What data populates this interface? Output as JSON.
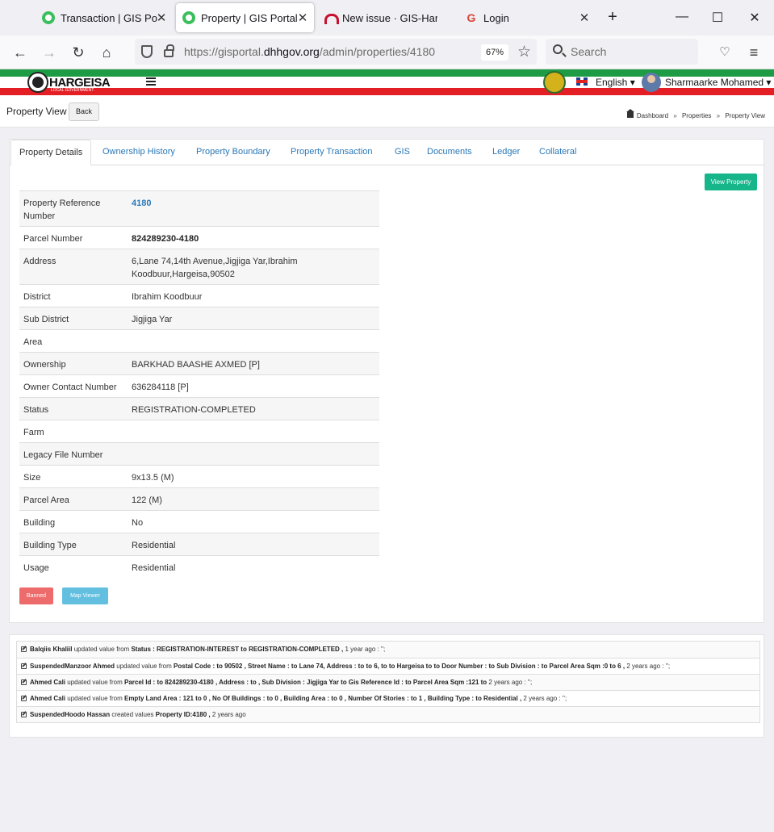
{
  "browser": {
    "tabs": [
      {
        "label": "Transaction | GIS Portal",
        "icon": "gis-favicon-icon",
        "active": false
      },
      {
        "label": "Property | GIS Portal",
        "icon": "gis-favicon-icon",
        "active": true
      },
      {
        "label": "New issue · GIS-Hargeisa",
        "icon": "issue-favicon-icon",
        "active": false
      },
      {
        "label": "Login",
        "icon": "google-favicon-icon",
        "active": false
      }
    ],
    "url_prefix": "https://gisportal.",
    "url_domain": "dhhgov.org",
    "url_path": "/admin/properties/4180",
    "zoom": "67%",
    "search_placeholder": "Search"
  },
  "site": {
    "logo_text": "HARGEISA",
    "logo_sub": "LOCAL GOVERNMENT",
    "language": "English",
    "user_name": "Sharmaarke Mohamed"
  },
  "page": {
    "title": "Property View",
    "back_label": "Back",
    "breadcrumb": [
      "Dashboard",
      "Properties",
      "Property View"
    ],
    "tabs": [
      "Property Details",
      "Ownership History",
      "Property Boundary",
      "Property Transaction",
      "GIS",
      "Documents",
      "Ledger",
      "Collateral"
    ],
    "view_property_label": "View Property",
    "banned_label": "Banned",
    "map_viewer_label": "Map Viewer"
  },
  "details": [
    {
      "key": "Property Reference Number",
      "value": "4180"
    },
    {
      "key": "Parcel Number",
      "value": "824289230-4180"
    },
    {
      "key": "Address",
      "value": "6,Lane 74,14th Avenue,Jigjiga Yar,Ibrahim Koodbuur,Hargeisa,90502"
    },
    {
      "key": "District",
      "value": "Ibrahim Koodbuur"
    },
    {
      "key": "Sub District",
      "value": "Jigjiga Yar"
    },
    {
      "key": "Area",
      "value": ""
    },
    {
      "key": "Ownership",
      "value": "BARKHAD BAASHE AXMED [P]"
    },
    {
      "key": "Owner Contact Number",
      "value": "636284118 [P]"
    },
    {
      "key": "Status",
      "value": "REGISTRATION-COMPLETED"
    },
    {
      "key": "Farm",
      "value": ""
    },
    {
      "key": "Legacy File Number",
      "value": ""
    },
    {
      "key": "Size",
      "value": "9x13.5 (M)"
    },
    {
      "key": "Parcel Area",
      "value": "122 (M)"
    },
    {
      "key": "Building",
      "value": "No"
    },
    {
      "key": "Building Type",
      "value": "Residential"
    },
    {
      "key": "Usage",
      "value": "Residential"
    }
  ],
  "activity": [
    {
      "user": "Balqiis Khaliil",
      "verb": "updated value from",
      "change": "Status : REGISTRATION-INTEREST to REGISTRATION-COMPLETED ,",
      "when": "1 year ago : '';"
    },
    {
      "user": "SuspendedManzoor Ahmed",
      "verb": "updated value from",
      "change": "Postal Code : to 90502 , Street Name : to Lane 74, Address : to to 6, to to Hargeisa to to Door Number : to Sub Division : to Parcel Area Sqm :0 to 6 ,",
      "when": "2 years ago : '';"
    },
    {
      "user": "Ahmed Cali",
      "verb": "updated value from",
      "change": "Parcel Id : to 824289230-4180 , Address : to , Sub Division : Jigjiga Yar to Gis Reference Id : to Parcel Area Sqm :121 to",
      "when": "2 years ago : '';"
    },
    {
      "user": "Ahmed Cali",
      "verb": "updated value from",
      "change": "Empty Land Area : 121 to 0 , No Of Buildings : to 0 , Building Area : to 0 , Number Of Stories : to 1 , Building Type : to Residential ,",
      "when": "2 years ago : '';"
    },
    {
      "user": "SuspendedHoodo Hassan",
      "verb": "created values",
      "change": "Property ID:4180 ,",
      "when": "2 years ago"
    }
  ]
}
